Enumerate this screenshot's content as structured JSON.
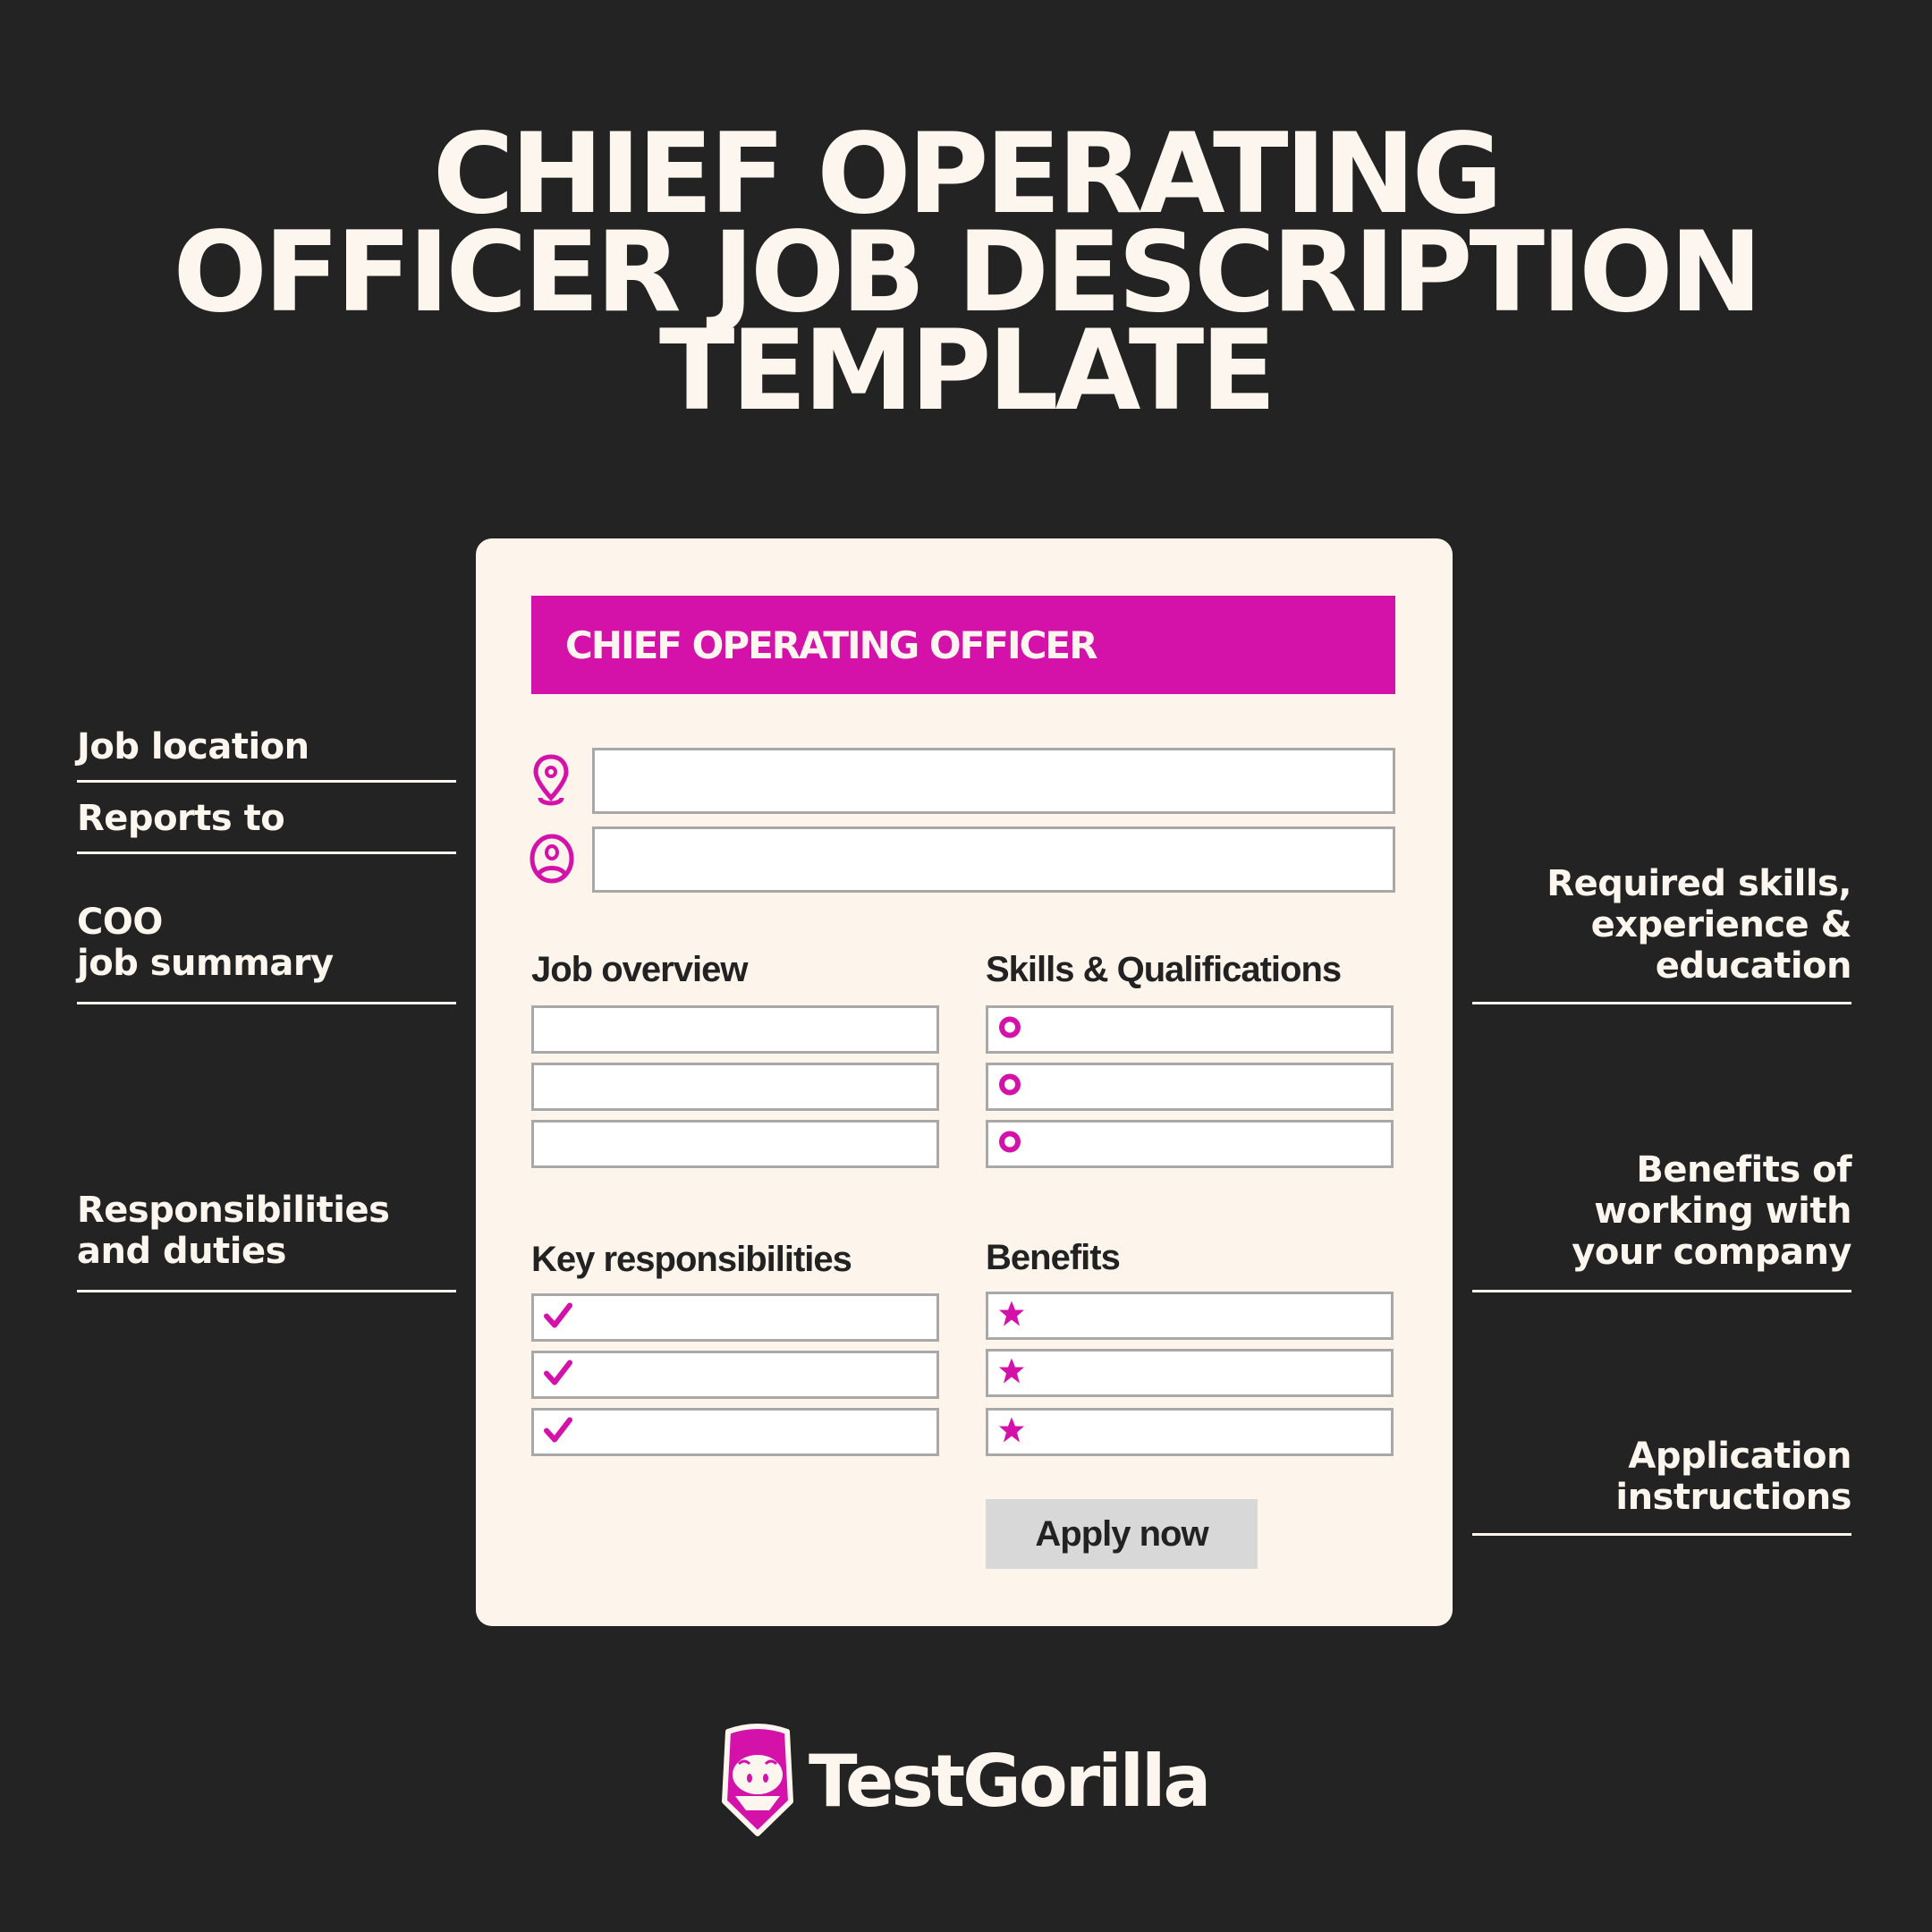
{
  "title": {
    "lines": [
      "CHIEF OPERATING",
      "OFFICER JOB DESCRIPTION",
      "TEMPLATE"
    ]
  },
  "card": {
    "banner_title": "CHIEF OPERATING OFFICER",
    "header_fields": [
      {
        "icon": "location-pin-icon",
        "value": ""
      },
      {
        "icon": "user-circle-icon",
        "value": ""
      }
    ],
    "sections": {
      "job_overview": {
        "label": "Job overview",
        "items": [
          "",
          "",
          ""
        ]
      },
      "skills": {
        "label": "Skills & Qualifications",
        "bullet_icon": "circle-bullet-icon",
        "items": [
          "",
          "",
          ""
        ]
      },
      "key_responsibilities": {
        "label": "Key responsibilities",
        "bullet_icon": "checkmark-icon",
        "items": [
          "",
          "",
          ""
        ]
      },
      "benefits": {
        "label": "Benefits",
        "bullet_icon": "star-icon",
        "items": [
          "",
          "",
          ""
        ]
      }
    },
    "apply_button": "Apply now"
  },
  "annotations": {
    "left": [
      {
        "text": "Job location"
      },
      {
        "text": "Reports to"
      },
      {
        "line1": "COO",
        "line2": "job summary"
      },
      {
        "line1": "Responsibilities",
        "line2": "and duties"
      }
    ],
    "right": [
      {
        "line1": "Required skills,",
        "line2": "experience &",
        "line3": "education"
      },
      {
        "line1": "Benefits of",
        "line2": "working with",
        "line3": "your company"
      },
      {
        "line1": "Application",
        "line2": "instructions"
      }
    ]
  },
  "brand": {
    "name": "TestGorilla",
    "accent_color": "#d412aa",
    "background_color": "#232323",
    "card_color": "#fdf4ec"
  }
}
